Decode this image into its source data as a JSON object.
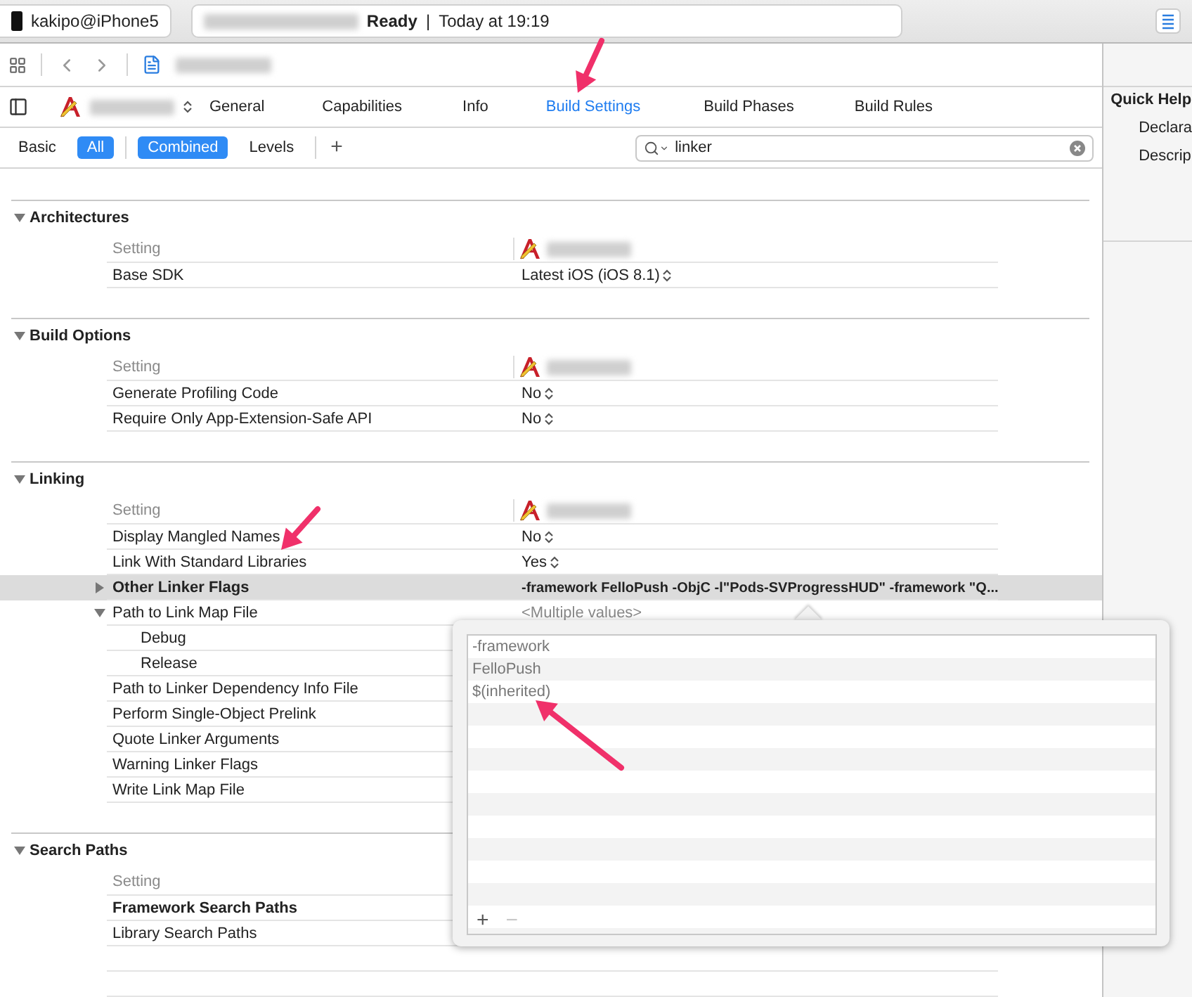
{
  "toolbar": {
    "device": "kakipo@iPhone5",
    "status": "Ready",
    "separator": "|",
    "time": "Today at 19:19"
  },
  "editor_tabs": [
    {
      "label": "General",
      "selected": false
    },
    {
      "label": "Capabilities",
      "selected": false
    },
    {
      "label": "Info",
      "selected": false
    },
    {
      "label": "Build Settings",
      "selected": true
    },
    {
      "label": "Build Phases",
      "selected": false
    },
    {
      "label": "Build Rules",
      "selected": false
    }
  ],
  "filter_bar": {
    "scopes": [
      {
        "label": "Basic",
        "selected": false
      },
      {
        "label": "All",
        "selected": true
      }
    ],
    "views": [
      {
        "label": "Combined",
        "selected": true
      },
      {
        "label": "Levels",
        "selected": false
      }
    ],
    "add": "+",
    "search": {
      "value": "linker"
    }
  },
  "sections": [
    {
      "title": "Architectures",
      "expanded": true,
      "column_header": "Setting",
      "target_shown": true,
      "rows": [
        {
          "name": "Base SDK",
          "value": "Latest iOS (iOS 8.1)",
          "kind": "popup",
          "modified": false,
          "selected": false
        }
      ]
    },
    {
      "title": "Build Options",
      "expanded": true,
      "column_header": "Setting",
      "target_shown": true,
      "rows": [
        {
          "name": "Generate Profiling Code",
          "value": "No",
          "kind": "popup",
          "modified": false,
          "selected": false
        },
        {
          "name": "Require Only App-Extension-Safe API",
          "value": "No",
          "kind": "popup",
          "modified": false,
          "selected": false
        }
      ]
    },
    {
      "title": "Linking",
      "expanded": true,
      "column_header": "Setting",
      "target_shown": true,
      "rows": [
        {
          "name": "Display Mangled Names",
          "value": "No",
          "kind": "popup",
          "modified": false,
          "selected": false
        },
        {
          "name": "Link With Standard Libraries",
          "value": "Yes",
          "kind": "popup",
          "modified": false,
          "selected": false
        },
        {
          "name": "Other Linker Flags",
          "value": "-framework FelloPush -ObjC -l\"Pods-SVProgressHUD\" -framework \"Q...",
          "kind": "text",
          "modified": true,
          "selected": true,
          "expanded": false
        },
        {
          "name": "Path to Link Map File",
          "value": "<Multiple values>",
          "kind": "multiple",
          "modified": false,
          "selected": false,
          "expanded": true,
          "children": [
            {
              "name": "Debug",
              "modified": false,
              "selected": false
            },
            {
              "name": "Release",
              "modified": false,
              "selected": false
            }
          ]
        },
        {
          "name": "Path to Linker Dependency Info File",
          "kind": "none",
          "modified": false,
          "selected": false
        },
        {
          "name": "Perform Single-Object Prelink",
          "kind": "none",
          "modified": false,
          "selected": false
        },
        {
          "name": "Quote Linker Arguments",
          "kind": "none",
          "modified": false,
          "selected": false
        },
        {
          "name": "Warning Linker Flags",
          "kind": "none",
          "modified": false,
          "selected": false
        },
        {
          "name": "Write Link Map File",
          "kind": "none",
          "modified": false,
          "selected": false
        }
      ]
    },
    {
      "title": "Search Paths",
      "expanded": true,
      "column_header": "Setting",
      "target_shown": false,
      "rows": [
        {
          "name": "Framework Search Paths",
          "kind": "none",
          "modified": true,
          "selected": false
        },
        {
          "name": "Library Search Paths",
          "kind": "none",
          "modified": false,
          "selected": false
        }
      ]
    }
  ],
  "popover": {
    "items": [
      {
        "text": "-framework"
      },
      {
        "text": "FelloPush"
      },
      {
        "text": "$(inherited)"
      }
    ],
    "add": {
      "label": "+",
      "disabled": false
    },
    "remove": {
      "label": "−",
      "disabled": true
    }
  },
  "inspector": {
    "title": "Quick Help",
    "items": [
      "Declara",
      "Descrip"
    ]
  }
}
